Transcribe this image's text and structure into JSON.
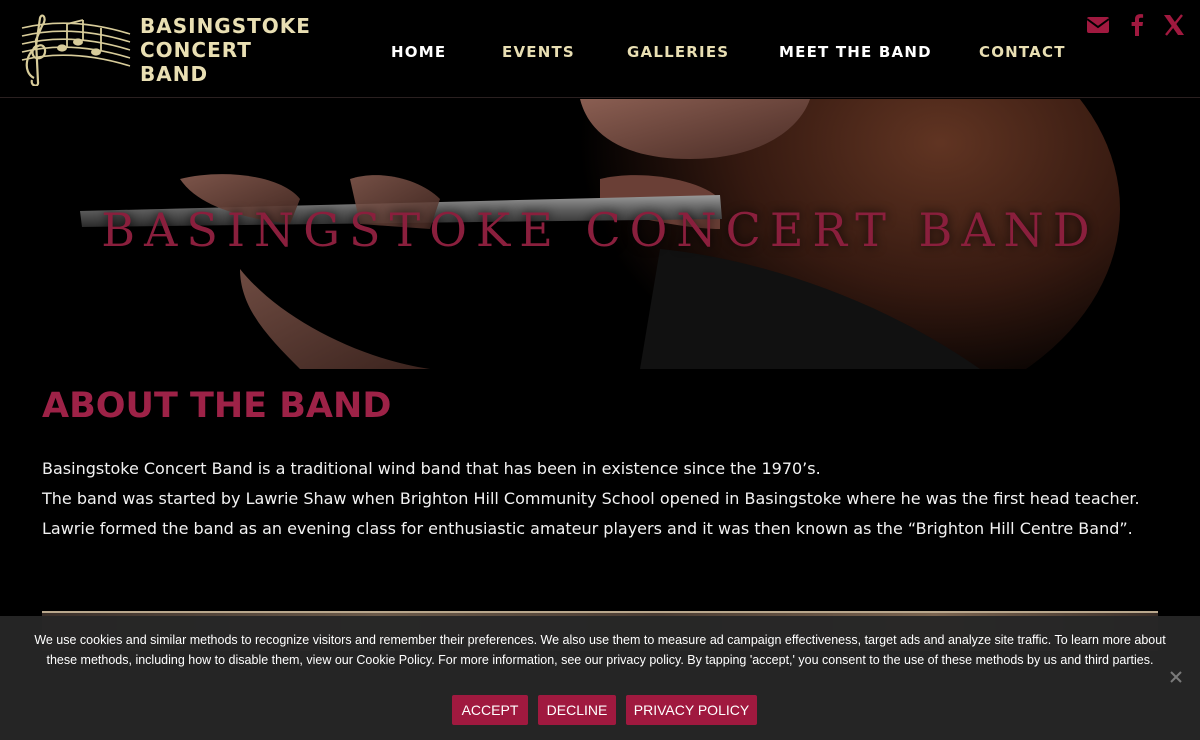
{
  "header": {
    "logo_lines": [
      "BASINGSTOKE",
      "CONCERT",
      "BAND"
    ],
    "nav": [
      "HOME",
      "EVENTS",
      "GALLERIES",
      "MEET THE BAND",
      "CONTACT"
    ],
    "social_icons": [
      "envelope-icon",
      "facebook-icon",
      "x-icon"
    ],
    "colors": {
      "gold": "#e9dfb3",
      "accent": "#9d2247"
    }
  },
  "hero": {
    "title": "BASINGSTOKE CONCERT BAND"
  },
  "about": {
    "heading": "ABOUT THE BAND",
    "paragraphs": [
      "Basingstoke Concert Band is a traditional wind band that has been in existence since the 1970’s.",
      "The band was started by Lawrie Shaw when Brighton Hill Community School opened in Basingstoke where he was the first head teacher. Lawrie formed the band as an evening class for enthusiastic amateur players and it was then known as the “Brighton Hill Centre Band”."
    ]
  },
  "cookie": {
    "text": "We use cookies and similar methods to recognize visitors and remember their preferences. We also use them to measure ad campaign effectiveness, target ads and analyze site traffic. To learn more about these methods, including how to disable them, view our Cookie Policy. For more information, see our privacy policy. By tapping 'accept,' you consent to the use of these methods by us and third parties.",
    "accept_label": "ACCEPT",
    "decline_label": "DECLINE",
    "privacy_label": "PRIVACY POLICY",
    "button_color": "#a0193f"
  }
}
